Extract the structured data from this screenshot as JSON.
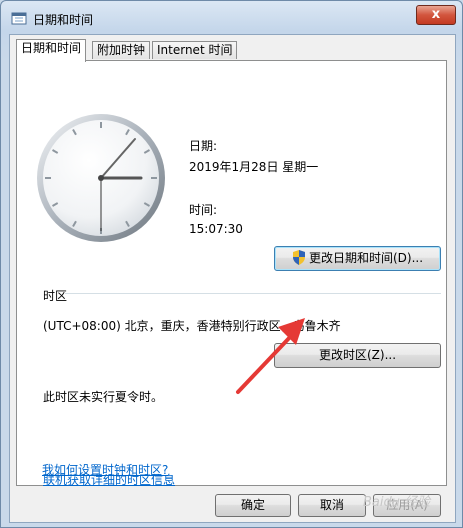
{
  "window": {
    "title": "日期和时间",
    "close_label": "x"
  },
  "tabs": [
    {
      "label": "日期和时间",
      "active": true
    },
    {
      "label": "附加时钟",
      "active": false
    },
    {
      "label": "Internet 时间",
      "active": false
    }
  ],
  "datetime": {
    "date_label": "日期:",
    "date_value": "2019年1月28日 星期一",
    "time_label": "时间:",
    "time_value": "15:07:30",
    "change_button": "更改日期和时间(D)..."
  },
  "timezone": {
    "section_label": "时区",
    "value": "(UTC+08:00) 北京，重庆，香港特别行政区，乌鲁木齐",
    "change_button": "更改时区(Z)...",
    "dst_note": "此时区未实行夏令时。"
  },
  "links": {
    "online_info": "联机获取详细的时区信息",
    "how_to": "我如何设置时钟和时区?"
  },
  "footer": {
    "ok": "确定",
    "cancel": "取消",
    "apply": "应用(A)"
  },
  "watermark": "Baidu 经验",
  "icons": {
    "app": "calendar-clock-icon",
    "shield": "uac-shield-icon",
    "arrow": "red-annotation-arrow"
  },
  "colors": {
    "link": "#0066cc",
    "arrow": "#e53935",
    "close": "#c43a22"
  }
}
